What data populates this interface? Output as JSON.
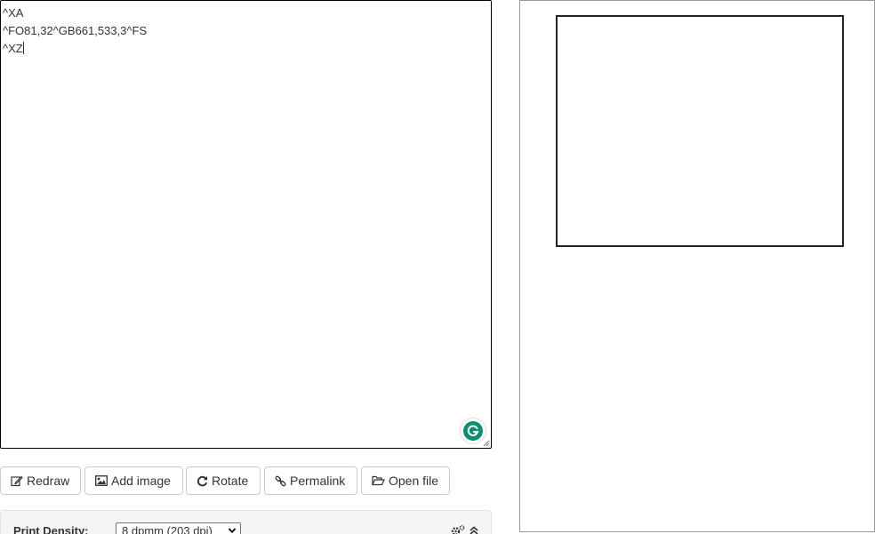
{
  "editor": {
    "lines": [
      "^XA",
      "^FO81,32^GB661,533,3^FS",
      "^XZ"
    ]
  },
  "toolbar": {
    "redraw_label": "Redraw",
    "add_image_label": "Add image",
    "rotate_label": "Rotate",
    "permalink_label": "Permalink",
    "open_file_label": "Open file"
  },
  "settings": {
    "density_label": "Print Density:",
    "density_value": "8 dpmm (203 dpi)"
  },
  "icons": {
    "redraw": "edit-icon",
    "add_image": "image-icon",
    "rotate": "rotate-icon",
    "permalink": "link-icon",
    "open_file": "folder-open-icon",
    "settings": "gears-icon",
    "collapse": "chevron-up-icon",
    "grammarly": "grammarly-icon"
  },
  "colors": {
    "grammarly": "#0b8f6f",
    "panel_bg": "#f5f5f5"
  }
}
